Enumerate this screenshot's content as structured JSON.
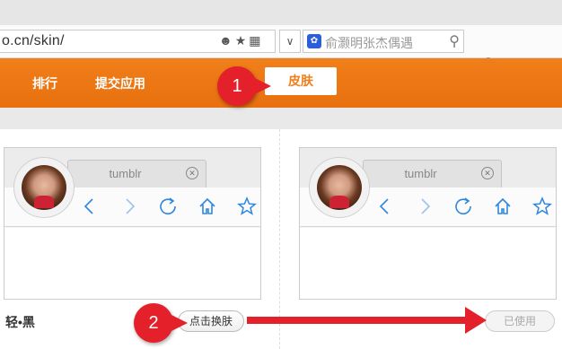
{
  "browser": {
    "url": "o.cn/skin/",
    "search_placeholder": "俞灏明张杰偶遇"
  },
  "nav": {
    "items": [
      {
        "label": "排行"
      },
      {
        "label": "提交应用"
      }
    ],
    "active_label": "皮肤"
  },
  "skins": [
    {
      "preview_tab_title": "tumblr",
      "name": "轻•黑",
      "button_label": "点击换肤",
      "state": "available"
    },
    {
      "preview_tab_title": "tumblr",
      "name": "",
      "button_label": "已使用",
      "state": "used"
    }
  ],
  "annotations": {
    "marker1": "1",
    "marker2": "2"
  },
  "colors": {
    "accent": "#f07f1a",
    "icon_blue": "#2f86e0",
    "marker_red": "#e4202a"
  }
}
